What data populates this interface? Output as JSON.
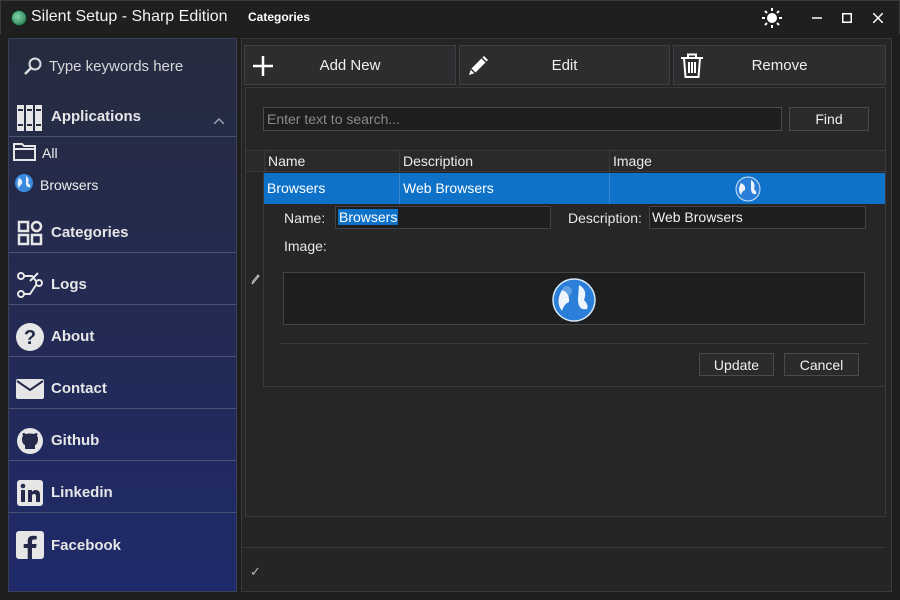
{
  "window": {
    "app_title": "Silent Setup - Sharp Edition",
    "page_title": "Categories"
  },
  "sidebar": {
    "search_placeholder": "Type keywords here",
    "groups": {
      "applications": {
        "label": "Applications"
      },
      "categories": {
        "label": "Categories"
      },
      "logs": {
        "label": "Logs"
      },
      "about": {
        "label": "About"
      },
      "contact": {
        "label": "Contact"
      },
      "github": {
        "label": "Github"
      },
      "linkedin": {
        "label": "Linkedin"
      },
      "facebook": {
        "label": "Facebook"
      }
    },
    "sub_items": {
      "all": {
        "label": "All"
      },
      "browsers": {
        "label": "Browsers"
      }
    }
  },
  "toolbar": {
    "add_new": "Add New",
    "edit": "Edit",
    "remove": "Remove"
  },
  "search": {
    "placeholder": "Enter text to search...",
    "find_label": "Find"
  },
  "grid": {
    "columns": [
      "Name",
      "Description",
      "Image"
    ],
    "rows": [
      {
        "name": "Browsers",
        "description": "Web Browsers",
        "image": "globe-icon"
      }
    ]
  },
  "edit_form": {
    "name_label": "Name:",
    "name_value": "Browsers",
    "description_label": "Description:",
    "description_value": "Web Browsers",
    "image_label": "Image:",
    "update_label": "Update",
    "cancel_label": "Cancel"
  },
  "colors": {
    "selection": "#0e72c9",
    "sidebar_top": "#262c3f",
    "sidebar_bottom": "#1f2a6a"
  }
}
